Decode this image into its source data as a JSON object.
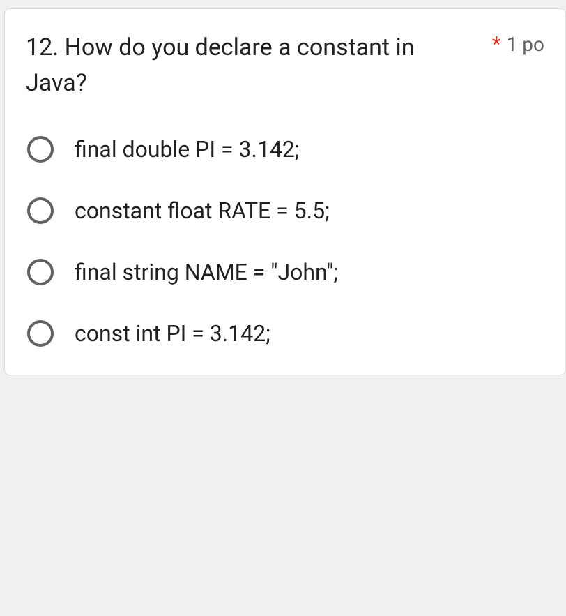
{
  "question": {
    "number": "12.",
    "text": "How do you declare a constant in Java?",
    "required_marker": "*",
    "points": "1 po"
  },
  "options": [
    {
      "label": "final double PI = 3.142;"
    },
    {
      "label": "constant float RATE = 5.5;"
    },
    {
      "label": "final string NAME = \"John\";"
    },
    {
      "label": "const int PI = 3.142;"
    }
  ]
}
